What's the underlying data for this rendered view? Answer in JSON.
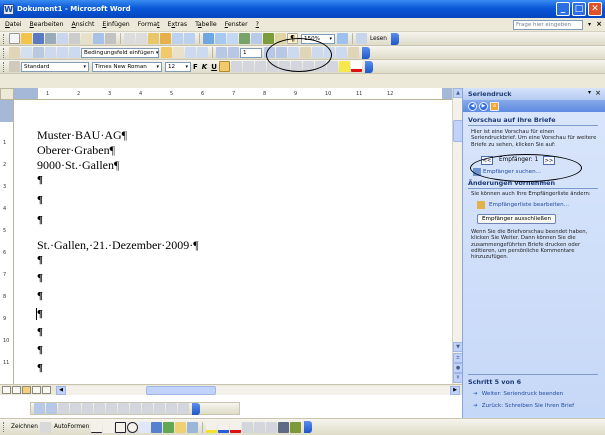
{
  "window": {
    "title": "Dokument1 - Microsoft Word",
    "app_icon": "W"
  },
  "menu": {
    "items": [
      {
        "pre": "",
        "u": "D",
        "post": "atei"
      },
      {
        "pre": "",
        "u": "B",
        "post": "earbeiten"
      },
      {
        "pre": "",
        "u": "A",
        "post": "nsicht"
      },
      {
        "pre": "",
        "u": "E",
        "post": "infügen"
      },
      {
        "pre": "Forma",
        "u": "t",
        "post": ""
      },
      {
        "pre": "E",
        "u": "x",
        "post": "tras"
      },
      {
        "pre": "T",
        "u": "a",
        "post": "belle"
      },
      {
        "pre": "",
        "u": "F",
        "post": "enster"
      },
      {
        "pre": "",
        "u": "?",
        "post": ""
      }
    ],
    "help_placeholder": "Frage hier eingeben"
  },
  "toolbar_standard": {
    "zoom": "150%",
    "read_label": "Lesen"
  },
  "toolbar_mailmerge": {
    "insert_field": "Bedingungsfeld einfügen",
    "record": "1"
  },
  "toolbar_format": {
    "style": "Standard",
    "font": "Times New Roman",
    "size": "12",
    "bold": "F",
    "italic": "K",
    "underline": "U"
  },
  "ruler": {
    "numbers": [
      "1",
      "2",
      "3",
      "4",
      "5",
      "6",
      "7",
      "8",
      "9",
      "10",
      "11",
      "12"
    ]
  },
  "vruler": {
    "numbers": [
      "1",
      "2",
      "3",
      "4",
      "5",
      "6",
      "7",
      "8",
      "9",
      "10",
      "11"
    ]
  },
  "document": {
    "lines": [
      "Muster·BAU·AG¶",
      "Oberer·Graben¶",
      "9000·St.·Gallen¶",
      "St.·Gallen,·21.·Dezember·2009·¶"
    ],
    "pilcrow": "¶"
  },
  "taskpane": {
    "title": "Seriendruck",
    "section1": "Vorschau auf Ihre Briefe",
    "section1_text": "Hier ist eine Vorschau für einen Seriendruckbrief. Um eine Vorschau für weitere Briefe zu sehen, klicken Sie auf:",
    "prev_btn": "<<",
    "next_btn": ">>",
    "recipient_label": "Empfänger: 1",
    "find_link": "Empfänger suchen...",
    "section2": "Änderungen vornehmen",
    "section2_text": "Sie können auch Ihre Empfängerliste ändern:",
    "edit_link": "Empfängerliste bearbeiten...",
    "exclude_btn": "Empfänger ausschließen",
    "body_text": "Wenn Sie die Briefvorschau beendet haben, klicken Sie Weiter. Dann können Sie die zusammengeführten Briefe drucken oder editieren, um persönliche Kommentare hinzuzufügen.",
    "step": "Schritt 5 von 6",
    "next_step": "Weiter: Seriendruck beenden",
    "prev_step": "Zurück: Schreiben Sie Ihren Brief"
  },
  "drawing": {
    "draw_label": "Zeichnen",
    "autoshapes_label": "AutoFormen"
  },
  "colors": {
    "title_blue": "#0a58d8",
    "pane_bg": "#d8e5fb",
    "link": "#224aa5"
  }
}
